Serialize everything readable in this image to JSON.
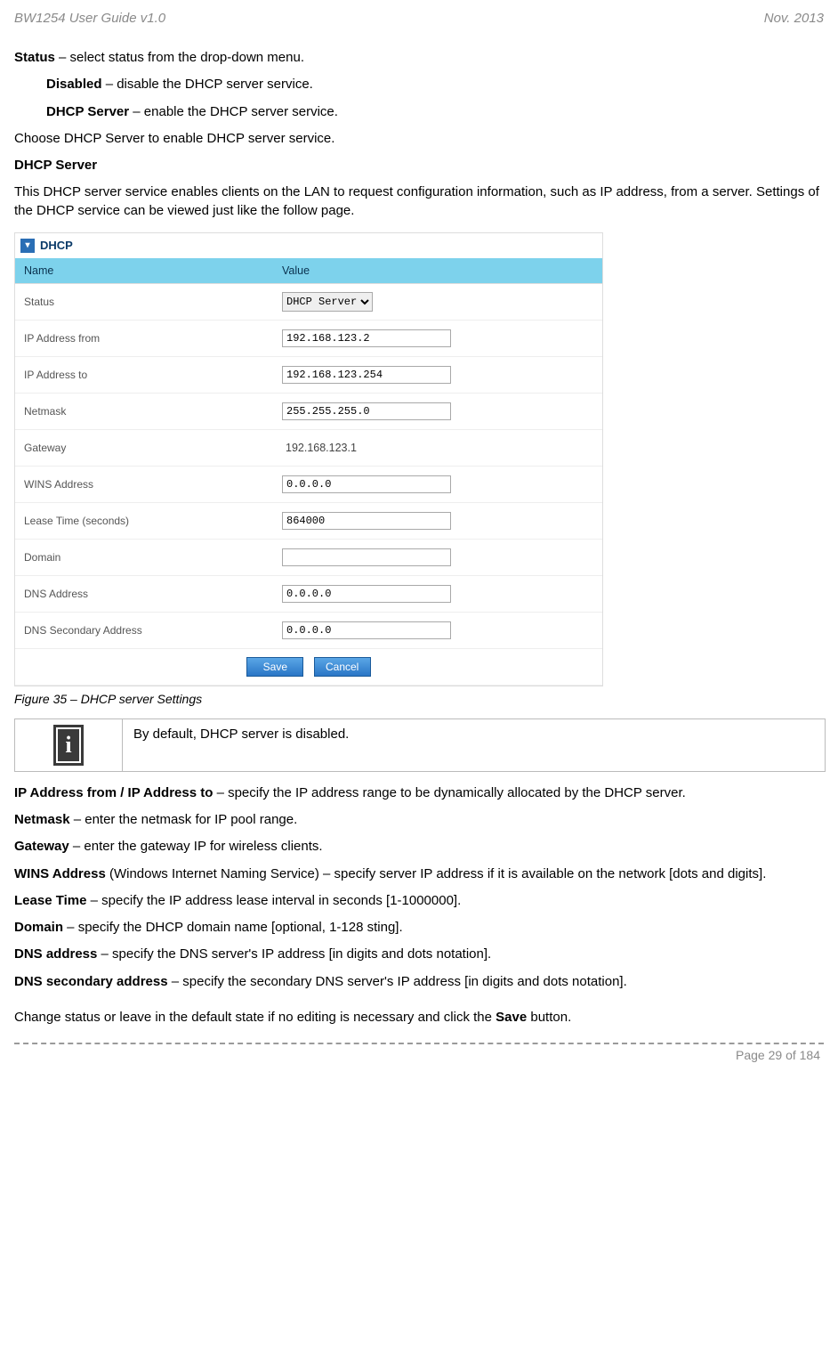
{
  "header": {
    "title": "BW1254 User Guide v1.0",
    "date": "Nov.  2013"
  },
  "intro": {
    "status_line_prefix": "Status",
    "status_line_rest": " – select status from the drop-down menu.",
    "disabled_label": "Disabled",
    "disabled_rest": " – disable the DHCP server service.",
    "dhcp_server_label": "DHCP Server",
    "dhcp_server_rest": " – enable the DHCP server service.",
    "choose_line": "Choose DHCP Server to enable DHCP server service.",
    "dhcp_server_heading": "DHCP Server",
    "dhcp_server_desc": "This DHCP server service enables clients on the LAN to request configuration information, such as IP address, from a server. Settings of the DHCP service can be viewed just like the follow page."
  },
  "screenshot": {
    "panel_title": "DHCP",
    "col_name": "Name",
    "col_value": "Value",
    "rows": {
      "status": {
        "name": "Status",
        "value": "DHCP Server"
      },
      "ip_from": {
        "name": "IP Address from",
        "value": "192.168.123.2"
      },
      "ip_to": {
        "name": "IP Address to",
        "value": "192.168.123.254"
      },
      "netmask": {
        "name": "Netmask",
        "value": "255.255.255.0"
      },
      "gateway": {
        "name": "Gateway",
        "value": "192.168.123.1"
      },
      "wins": {
        "name": "WINS Address",
        "value": "0.0.0.0"
      },
      "lease": {
        "name": "Lease Time (seconds)",
        "value": "864000"
      },
      "domain": {
        "name": "Domain",
        "value": ""
      },
      "dns": {
        "name": "DNS Address",
        "value": "0.0.0.0"
      },
      "dns2": {
        "name": "DNS Secondary Address",
        "value": "0.0.0.0"
      }
    },
    "buttons": {
      "save": "Save",
      "cancel": "Cancel"
    }
  },
  "figure_caption": "Figure 35 – DHCP server Settings",
  "info_box": {
    "text": "By default, DHCP server is disabled."
  },
  "definitions": {
    "ip_range_label": "IP Address from / IP Address to",
    "ip_range_rest": " – specify the IP address range to be dynamically allocated by the DHCP server.",
    "netmask_label": "Netmask",
    "netmask_rest": " – enter the netmask for IP pool range.",
    "gateway_label": "Gateway",
    "gateway_rest": " – enter the gateway IP for wireless clients.",
    "wins_label": "WINS Address",
    "wins_mid": " (Windows Internet Naming Service) – specify server IP address if it is available on the network [dots and digits].",
    "lease_label": "Lease Time",
    "lease_rest": " – specify the IP address lease interval in seconds [1-1000000].",
    "domain_label": "Domain",
    "domain_rest": " – specify the DHCP domain name [optional, 1-128 sting].",
    "dns_label": "DNS address",
    "dns_rest": " – specify the DNS server's IP address [in digits and dots notation].",
    "dns2_label": "DNS secondary address",
    "dns2_rest": " – specify the secondary DNS server's IP address [in digits and dots notation].",
    "change_line_pre": "Change status or leave in the default state if no editing is necessary and click the ",
    "change_line_bold": "Save",
    "change_line_post": " button."
  },
  "footer": {
    "page": "Page 29 of 184"
  }
}
